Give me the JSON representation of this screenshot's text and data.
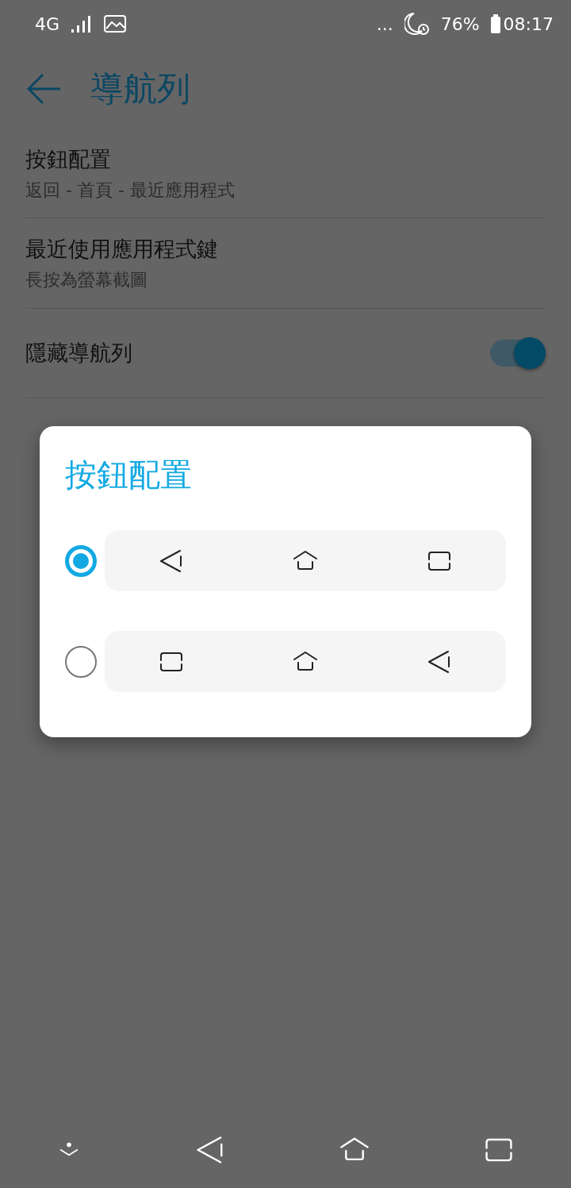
{
  "status_bar": {
    "network": "4G",
    "overflow": "...",
    "battery": "76%",
    "time": "08:17"
  },
  "header": {
    "title": "導航列"
  },
  "settings": [
    {
      "kind": "text",
      "title": "按鈕配置",
      "subtitle": "返回 - 首頁 - 最近應用程式"
    },
    {
      "kind": "text",
      "title": "最近使用應用程式鍵",
      "subtitle": "長按為螢幕截圖"
    },
    {
      "kind": "switch",
      "title": "隱藏導航列",
      "on": true
    }
  ],
  "dialog": {
    "title": "按鈕配置",
    "options": [
      {
        "selected": true,
        "buttons": [
          {
            "kind": "back"
          },
          {
            "kind": "home"
          },
          {
            "kind": "recent"
          }
        ]
      },
      {
        "selected": false,
        "buttons": [
          {
            "kind": "recent"
          },
          {
            "kind": "home"
          },
          {
            "kind": "back"
          }
        ]
      }
    ]
  },
  "nav_bar": [
    {
      "kind": "hide"
    },
    {
      "kind": "back"
    },
    {
      "kind": "home"
    },
    {
      "kind": "recent"
    }
  ]
}
